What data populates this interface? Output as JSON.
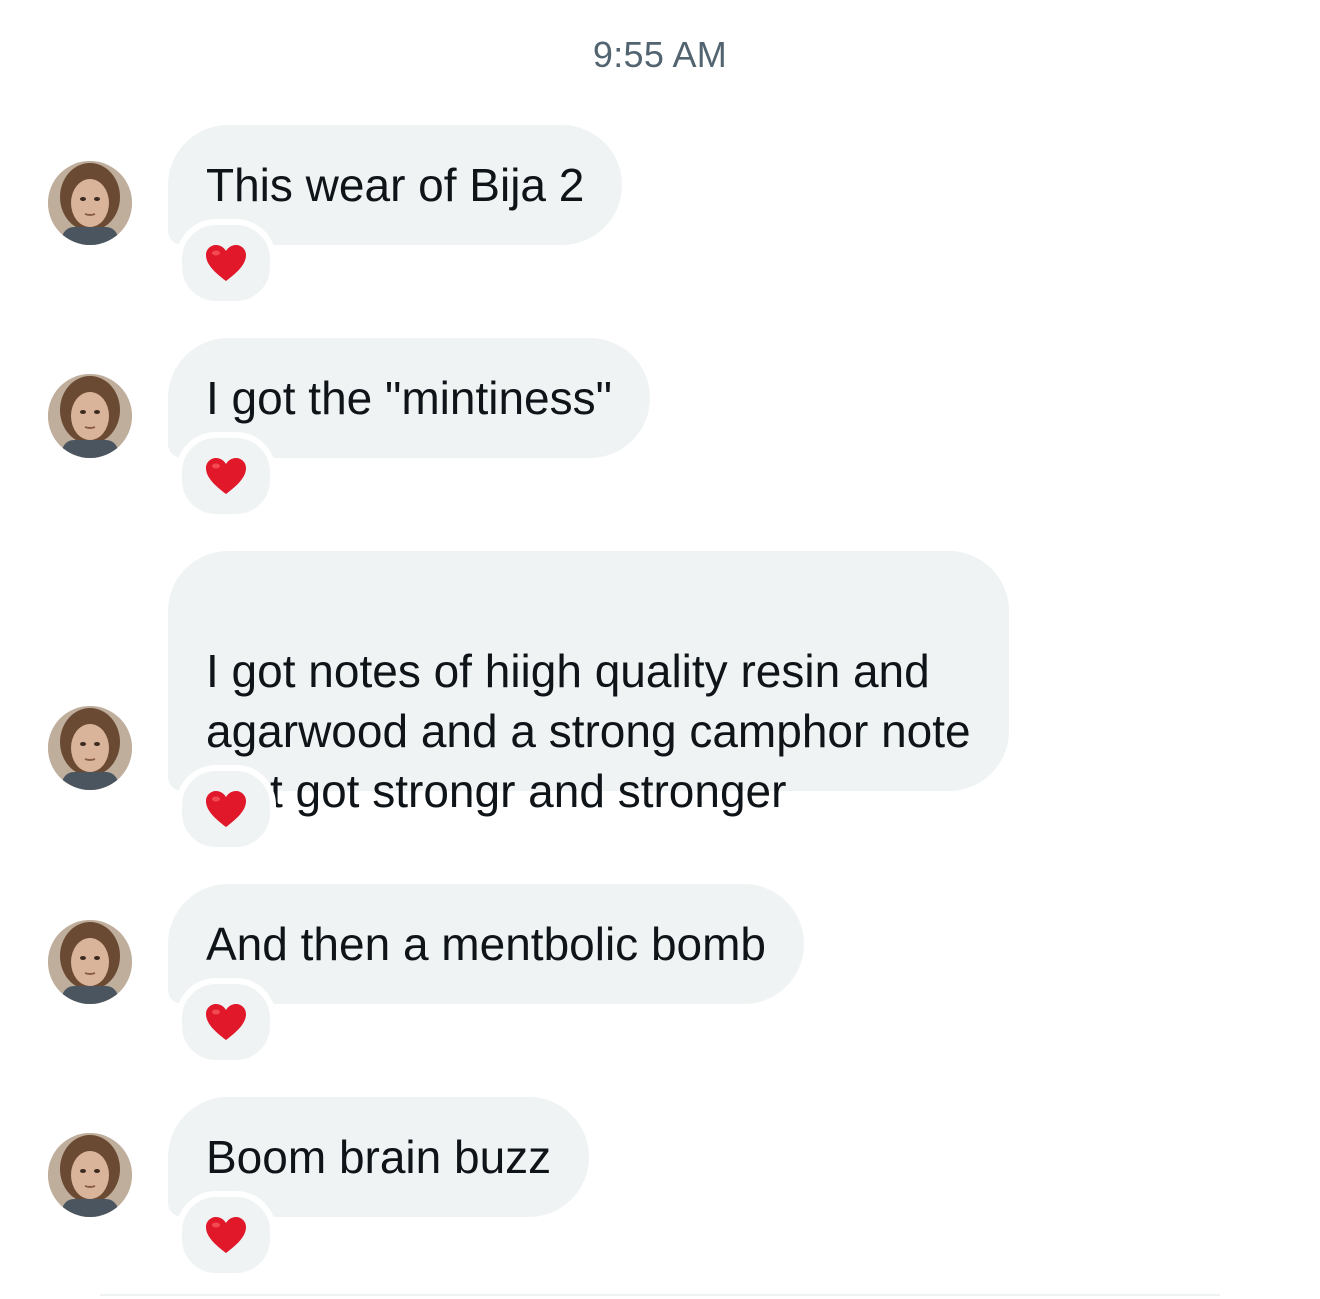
{
  "conversation": {
    "timestamp": "9:55 AM",
    "messages": [
      {
        "text": "This wear of Bija 2",
        "reaction": "heart-emoji"
      },
      {
        "text": "I got the \"mintiness\"",
        "reaction": "heart-emoji"
      },
      {
        "text": "I got notes of hiigh quality resin and\nagarwood and a strong camphor note\nthat got strongr and stronger",
        "reaction": "heart-emoji"
      },
      {
        "text": "And then a mentbolic bomb",
        "reaction": "heart-emoji"
      },
      {
        "text": "Boom brain buzz",
        "reaction": "heart-emoji"
      }
    ]
  },
  "colors": {
    "bubble": "#eff3f4",
    "text": "#0f1419",
    "timestamp": "#536471",
    "heart": "#e0182a"
  }
}
